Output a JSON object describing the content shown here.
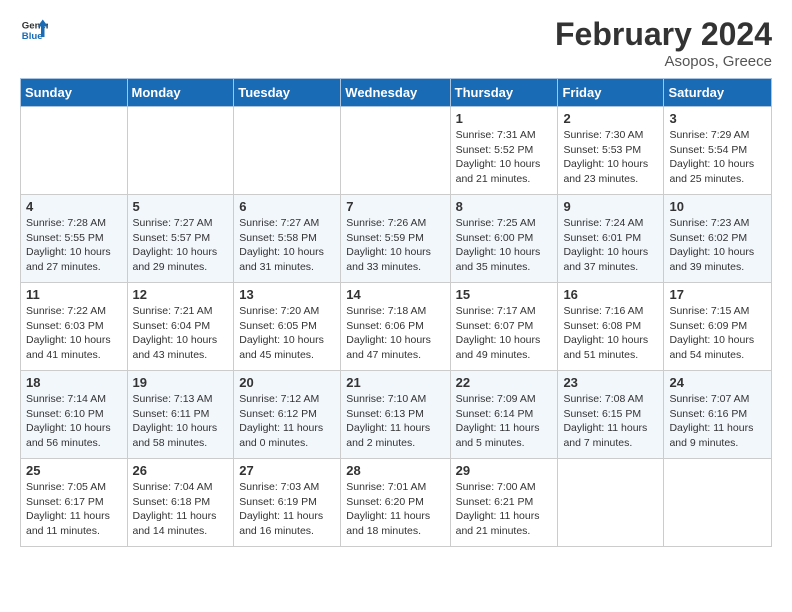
{
  "logo": {
    "text_general": "General",
    "text_blue": "Blue"
  },
  "title": {
    "month_year": "February 2024",
    "location": "Asopos, Greece"
  },
  "weekdays": [
    "Sunday",
    "Monday",
    "Tuesday",
    "Wednesday",
    "Thursday",
    "Friday",
    "Saturday"
  ],
  "weeks": [
    [
      {
        "day": "",
        "info": ""
      },
      {
        "day": "",
        "info": ""
      },
      {
        "day": "",
        "info": ""
      },
      {
        "day": "",
        "info": ""
      },
      {
        "day": "1",
        "info": "Sunrise: 7:31 AM\nSunset: 5:52 PM\nDaylight: 10 hours\nand 21 minutes."
      },
      {
        "day": "2",
        "info": "Sunrise: 7:30 AM\nSunset: 5:53 PM\nDaylight: 10 hours\nand 23 minutes."
      },
      {
        "day": "3",
        "info": "Sunrise: 7:29 AM\nSunset: 5:54 PM\nDaylight: 10 hours\nand 25 minutes."
      }
    ],
    [
      {
        "day": "4",
        "info": "Sunrise: 7:28 AM\nSunset: 5:55 PM\nDaylight: 10 hours\nand 27 minutes."
      },
      {
        "day": "5",
        "info": "Sunrise: 7:27 AM\nSunset: 5:57 PM\nDaylight: 10 hours\nand 29 minutes."
      },
      {
        "day": "6",
        "info": "Sunrise: 7:27 AM\nSunset: 5:58 PM\nDaylight: 10 hours\nand 31 minutes."
      },
      {
        "day": "7",
        "info": "Sunrise: 7:26 AM\nSunset: 5:59 PM\nDaylight: 10 hours\nand 33 minutes."
      },
      {
        "day": "8",
        "info": "Sunrise: 7:25 AM\nSunset: 6:00 PM\nDaylight: 10 hours\nand 35 minutes."
      },
      {
        "day": "9",
        "info": "Sunrise: 7:24 AM\nSunset: 6:01 PM\nDaylight: 10 hours\nand 37 minutes."
      },
      {
        "day": "10",
        "info": "Sunrise: 7:23 AM\nSunset: 6:02 PM\nDaylight: 10 hours\nand 39 minutes."
      }
    ],
    [
      {
        "day": "11",
        "info": "Sunrise: 7:22 AM\nSunset: 6:03 PM\nDaylight: 10 hours\nand 41 minutes."
      },
      {
        "day": "12",
        "info": "Sunrise: 7:21 AM\nSunset: 6:04 PM\nDaylight: 10 hours\nand 43 minutes."
      },
      {
        "day": "13",
        "info": "Sunrise: 7:20 AM\nSunset: 6:05 PM\nDaylight: 10 hours\nand 45 minutes."
      },
      {
        "day": "14",
        "info": "Sunrise: 7:18 AM\nSunset: 6:06 PM\nDaylight: 10 hours\nand 47 minutes."
      },
      {
        "day": "15",
        "info": "Sunrise: 7:17 AM\nSunset: 6:07 PM\nDaylight: 10 hours\nand 49 minutes."
      },
      {
        "day": "16",
        "info": "Sunrise: 7:16 AM\nSunset: 6:08 PM\nDaylight: 10 hours\nand 51 minutes."
      },
      {
        "day": "17",
        "info": "Sunrise: 7:15 AM\nSunset: 6:09 PM\nDaylight: 10 hours\nand 54 minutes."
      }
    ],
    [
      {
        "day": "18",
        "info": "Sunrise: 7:14 AM\nSunset: 6:10 PM\nDaylight: 10 hours\nand 56 minutes."
      },
      {
        "day": "19",
        "info": "Sunrise: 7:13 AM\nSunset: 6:11 PM\nDaylight: 10 hours\nand 58 minutes."
      },
      {
        "day": "20",
        "info": "Sunrise: 7:12 AM\nSunset: 6:12 PM\nDaylight: 11 hours\nand 0 minutes."
      },
      {
        "day": "21",
        "info": "Sunrise: 7:10 AM\nSunset: 6:13 PM\nDaylight: 11 hours\nand 2 minutes."
      },
      {
        "day": "22",
        "info": "Sunrise: 7:09 AM\nSunset: 6:14 PM\nDaylight: 11 hours\nand 5 minutes."
      },
      {
        "day": "23",
        "info": "Sunrise: 7:08 AM\nSunset: 6:15 PM\nDaylight: 11 hours\nand 7 minutes."
      },
      {
        "day": "24",
        "info": "Sunrise: 7:07 AM\nSunset: 6:16 PM\nDaylight: 11 hours\nand 9 minutes."
      }
    ],
    [
      {
        "day": "25",
        "info": "Sunrise: 7:05 AM\nSunset: 6:17 PM\nDaylight: 11 hours\nand 11 minutes."
      },
      {
        "day": "26",
        "info": "Sunrise: 7:04 AM\nSunset: 6:18 PM\nDaylight: 11 hours\nand 14 minutes."
      },
      {
        "day": "27",
        "info": "Sunrise: 7:03 AM\nSunset: 6:19 PM\nDaylight: 11 hours\nand 16 minutes."
      },
      {
        "day": "28",
        "info": "Sunrise: 7:01 AM\nSunset: 6:20 PM\nDaylight: 11 hours\nand 18 minutes."
      },
      {
        "day": "29",
        "info": "Sunrise: 7:00 AM\nSunset: 6:21 PM\nDaylight: 11 hours\nand 21 minutes."
      },
      {
        "day": "",
        "info": ""
      },
      {
        "day": "",
        "info": ""
      }
    ]
  ]
}
